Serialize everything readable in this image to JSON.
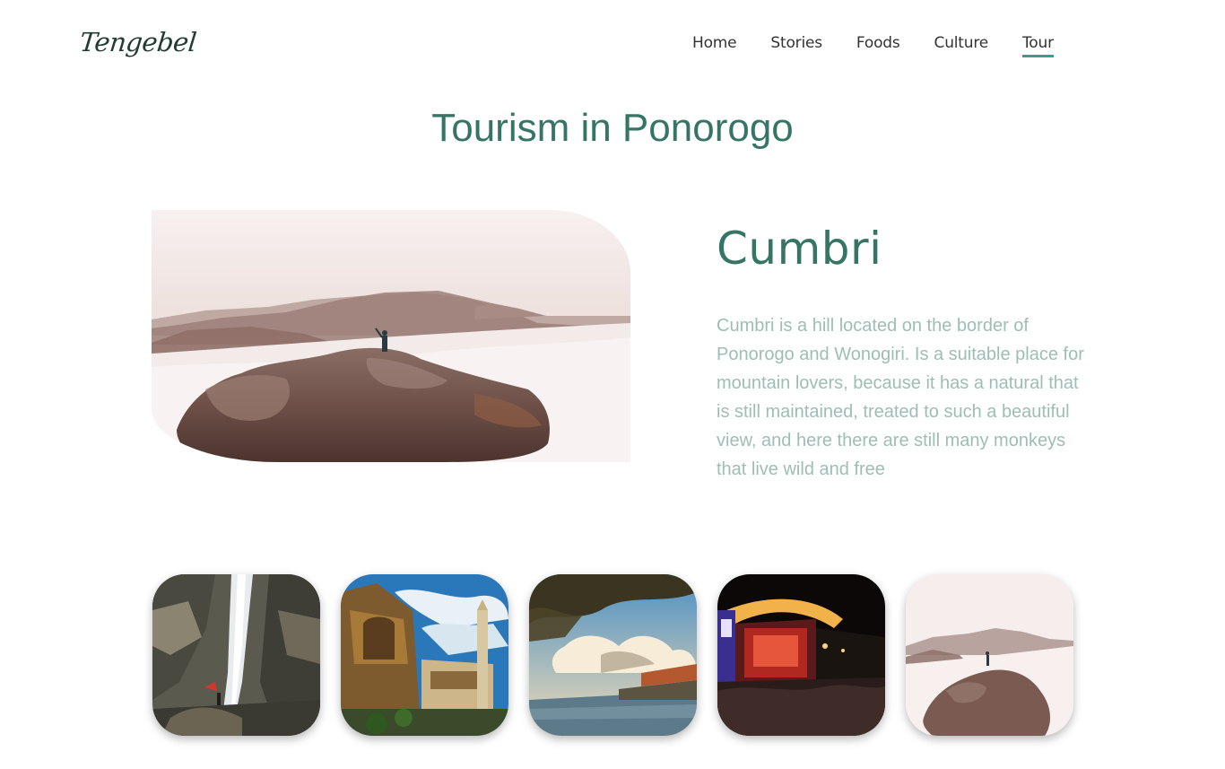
{
  "brand": {
    "logo_text": "Tengebel"
  },
  "nav": {
    "items": [
      {
        "label": "Home"
      },
      {
        "label": "Stories"
      },
      {
        "label": "Foods"
      },
      {
        "label": "Culture"
      },
      {
        "label": "Tour",
        "active": true
      }
    ]
  },
  "page": {
    "title": "Tourism in Ponorogo"
  },
  "featured": {
    "name": "Cumbri",
    "description": "Cumbri is a hill located on the border of Ponorogo and Wonogiri. Is a suitable place for mountain lovers, because it has a natural that is still maintained, treated to such a beautiful view, and here there are still many monkeys that live wild and free"
  },
  "colors": {
    "accent": "#367566",
    "nav_underline": "#3a9e8a",
    "description_text": "#9dbeb4"
  }
}
